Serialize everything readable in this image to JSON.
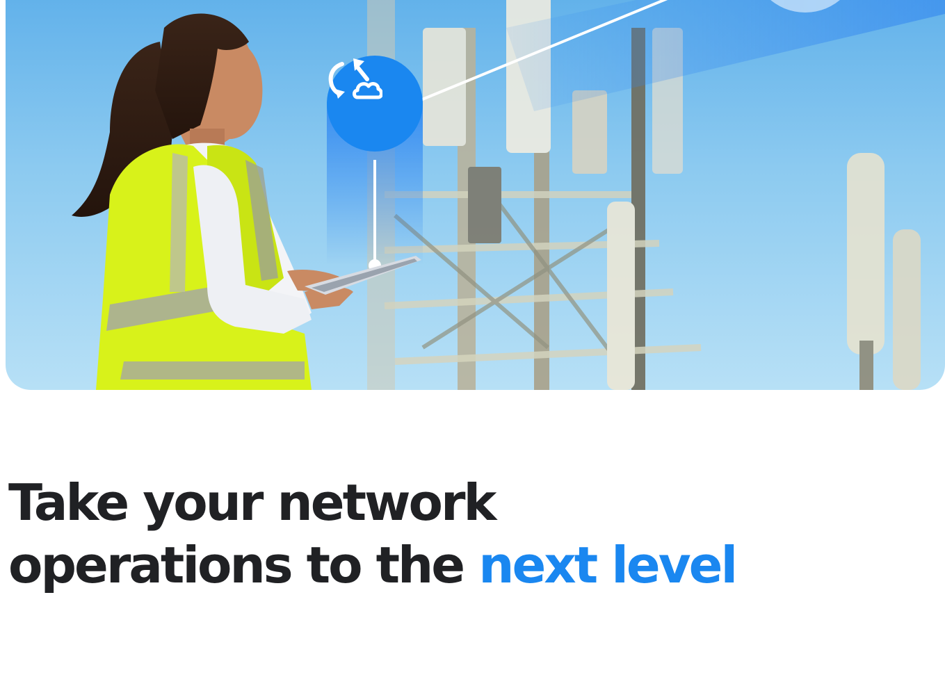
{
  "hero": {
    "image": "field-engineer-with-tablet-at-cell-tower",
    "badge_icon": "cloud-sync-icon",
    "colors": {
      "sky_top": "#5fb0ea",
      "sky_bottom": "#b7e0f6",
      "badge_blue": "#1a87f0",
      "vest_yellow": "#d8f21a"
    }
  },
  "headline": {
    "line1": "Take your network",
    "line2_prefix": "operations to the ",
    "line2_accent": "next level",
    "accent_color": "#1a87f0",
    "text_color": "#202124"
  }
}
